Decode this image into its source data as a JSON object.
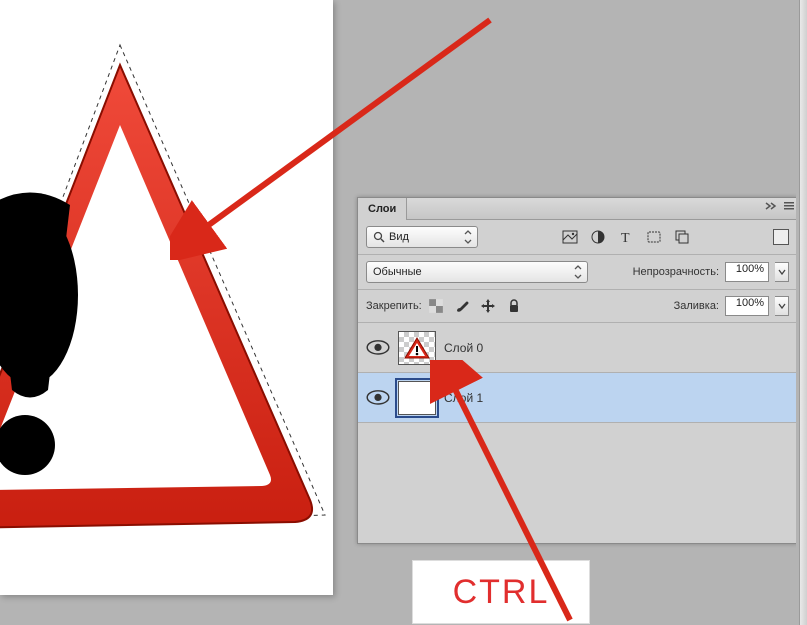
{
  "panel": {
    "tab_label": "Слои",
    "search_label": "Вид",
    "blend_label": "Обычные",
    "opacity_label": "Непрозрачность:",
    "opacity_value": "100%",
    "lock_label": "Закрепить:",
    "fill_label": "Заливка:",
    "fill_value": "100%"
  },
  "layers": [
    {
      "name": "Слой 0",
      "selected": false,
      "thumb": "warning"
    },
    {
      "name": "Слой 1",
      "selected": true,
      "thumb": "white"
    }
  ],
  "annotation": {
    "ctrl": "CTRL"
  },
  "icons": {
    "search": "search-icon",
    "image": "image-filter-icon",
    "adjust": "adjust-filter-icon",
    "type": "type-filter-icon",
    "shape": "shape-filter-icon",
    "smart": "smartobject-filter-icon",
    "pixel_lock": "lock-pixels-icon",
    "brush": "brush-icon",
    "move": "move-icon",
    "lock": "lock-icon",
    "eye": "eye-icon",
    "collapse": "collapse-icon",
    "menu": "panel-menu-icon"
  }
}
